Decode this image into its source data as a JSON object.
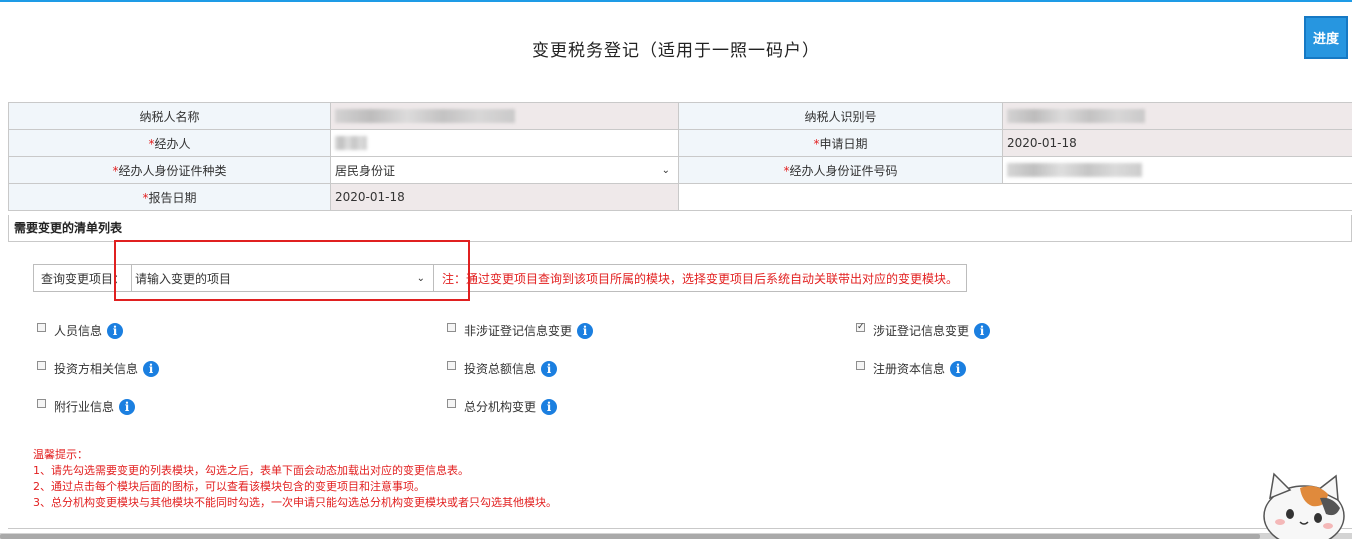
{
  "page": {
    "title": "变更税务登记（适用于一照一码户）",
    "progress_button": "进度"
  },
  "info_table": {
    "taxpayer_name_label": "纳税人名称",
    "taxpayer_id_label": "纳税人识别号",
    "agent_label": "经办人",
    "apply_date_label": "申请日期",
    "apply_date_value": "2020-01-18",
    "id_type_label": "经办人身份证件种类",
    "id_type_value": "居民身份证",
    "id_number_label": "经办人身份证件号码",
    "report_date_label": "报告日期",
    "report_date_value": "2020-01-18",
    "required_mark": "*"
  },
  "change_list": {
    "header": "需要变更的清单列表",
    "query_label": "查询变更项目：",
    "query_placeholder": "请输入变更的项目",
    "query_note": "注：通过变更项目查询到该项目所属的模块，选择变更项目后系统自动关联带出对应的变更模块。",
    "modules": [
      {
        "label": "人员信息",
        "checked": false
      },
      {
        "label": "非涉证登记信息变更",
        "checked": false
      },
      {
        "label": "涉证登记信息变更",
        "checked": true
      },
      {
        "label": "投资方相关信息",
        "checked": false
      },
      {
        "label": "投资总额信息",
        "checked": false
      },
      {
        "label": "注册资本信息",
        "checked": false
      },
      {
        "label": "附行业信息",
        "checked": false
      },
      {
        "label": "总分机构变更",
        "checked": false
      }
    ],
    "info_glyph": "i",
    "check_glyph": "✓"
  },
  "tips": {
    "title": "温馨提示：",
    "lines": [
      "1、请先勾选需要变更的列表模块，勾选之后，表单下面会动态加载出对应的变更信息表。",
      "2、通过点击每个模块后面的图标，可以查看该模块包含的变更项目和注意事项。",
      "3、总分机构变更模块与其他模块不能同时勾选，一次申请只能勾选总分机构变更模块或者只勾选其他模块。"
    ]
  },
  "colors": {
    "accent": "#2796e0",
    "required": "#e21f1f",
    "info_icon": "#1b7fe0"
  }
}
